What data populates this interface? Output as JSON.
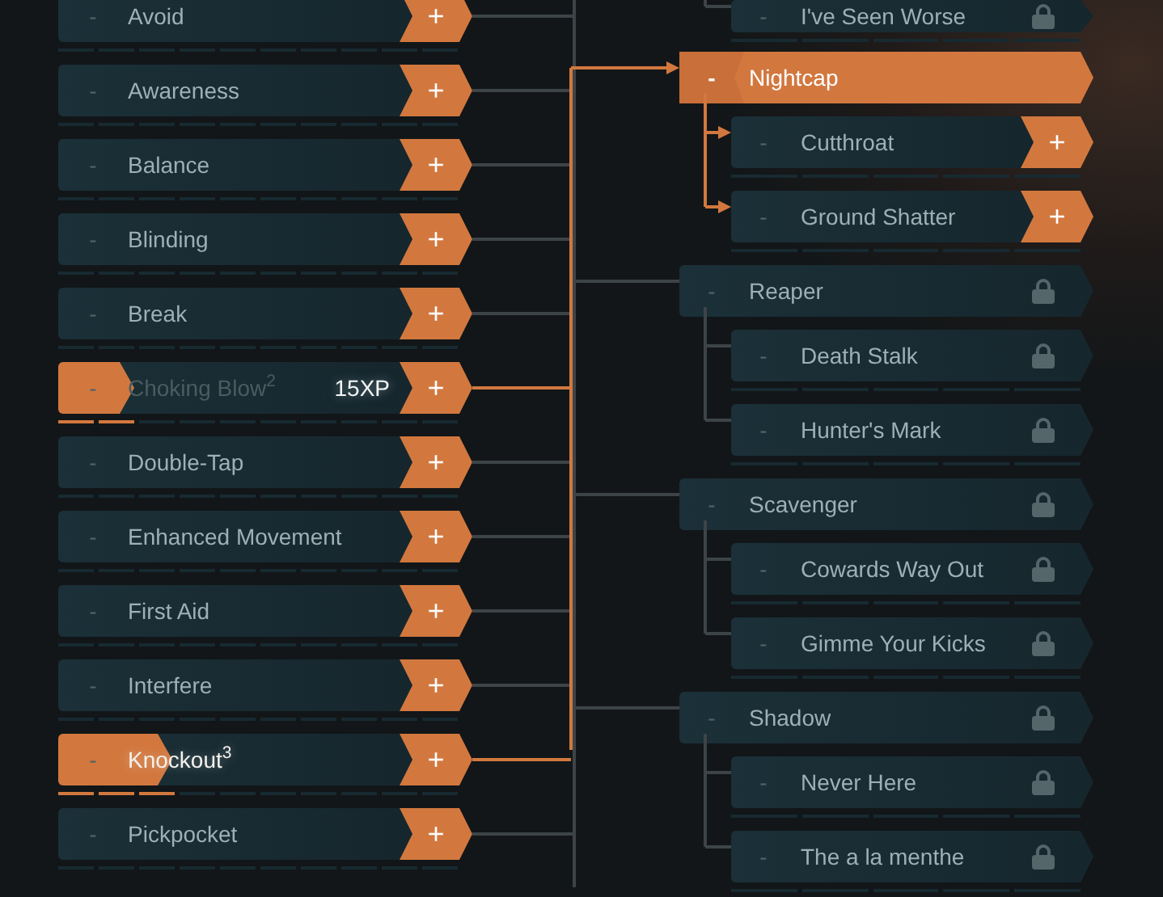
{
  "skills": [
    {
      "minus": "-",
      "name": "Avoid",
      "plus": "+",
      "level": 0,
      "faded": false,
      "highlighted": false,
      "linked": false
    },
    {
      "minus": "-",
      "name": "Awareness",
      "plus": "+",
      "level": 0,
      "faded": false,
      "highlighted": false,
      "linked": false
    },
    {
      "minus": "-",
      "name": "Balance",
      "plus": "+",
      "level": 0,
      "faded": false,
      "highlighted": false,
      "linked": false
    },
    {
      "minus": "-",
      "name": "Blinding",
      "plus": "+",
      "level": 0,
      "faded": false,
      "highlighted": false,
      "linked": false
    },
    {
      "minus": "-",
      "name": "Break",
      "plus": "+",
      "level": 0,
      "faded": false,
      "highlighted": false,
      "linked": false
    },
    {
      "minus": "-",
      "name": "Choking Blow$^{2}$",
      "xp": "15XP",
      "plus": "+",
      "level": 0.2,
      "faded": true,
      "highlighted": false,
      "linked": true
    },
    {
      "minus": "-",
      "name": "Double-Tap",
      "plus": "+",
      "level": 0,
      "faded": false,
      "highlighted": false,
      "linked": false
    },
    {
      "minus": "-",
      "name": "Enhanced Movement",
      "plus": "+",
      "level": 0,
      "faded": false,
      "highlighted": false,
      "linked": false
    },
    {
      "minus": "-",
      "name": "First Aid",
      "plus": "+",
      "level": 0,
      "faded": false,
      "highlighted": false,
      "linked": false
    },
    {
      "minus": "-",
      "name": "Interfere",
      "plus": "+",
      "level": 0,
      "faded": false,
      "highlighted": false,
      "linked": false
    },
    {
      "minus": "-",
      "name": "Knockout$^{3}$",
      "plus": "+",
      "level": 0.3,
      "faded": false,
      "highlighted": true,
      "linked": true
    },
    {
      "minus": "-",
      "name": "Pickpocket",
      "plus": "+",
      "level": 0,
      "faded": false,
      "highlighted": false,
      "linked": false
    }
  ],
  "branches": [
    {
      "children": [
        {
          "minus": "-",
          "name": "I've Seen Worse",
          "locked": true
        }
      ]
    },
    {
      "minus": "-",
      "name": "Nightcap",
      "active": true,
      "locked": false,
      "children": [
        {
          "minus": "-",
          "name": "Cutthroat",
          "locked": false,
          "plus": "+"
        },
        {
          "minus": "-",
          "name": "Ground Shatter",
          "locked": false,
          "plus": "+"
        }
      ]
    },
    {
      "minus": "-",
      "name": "Reaper",
      "active": false,
      "locked": true,
      "children": [
        {
          "minus": "-",
          "name": "Death Stalk",
          "locked": true
        },
        {
          "minus": "-",
          "name": "Hunter's Mark",
          "locked": true
        }
      ]
    },
    {
      "minus": "-",
      "name": "Scavenger",
      "active": false,
      "locked": true,
      "children": [
        {
          "minus": "-",
          "name": "Cowards Way Out",
          "locked": true
        },
        {
          "minus": "-",
          "name": "Gimme Your Kicks",
          "locked": true
        }
      ]
    },
    {
      "minus": "-",
      "name": "Shadow",
      "active": false,
      "locked": true,
      "children": [
        {
          "minus": "-",
          "name": "Never Here",
          "locked": true
        },
        {
          "minus": "-",
          "name": "The a la menthe",
          "locked": true
        }
      ]
    }
  ]
}
